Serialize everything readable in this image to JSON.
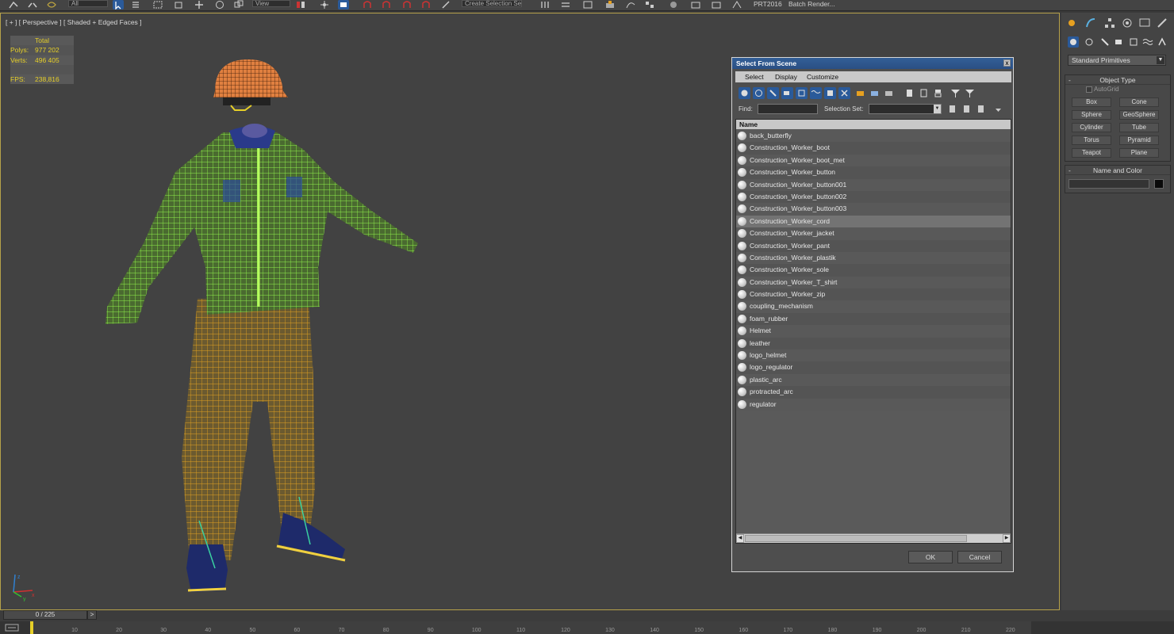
{
  "toolbar": {
    "filter_combo": "All",
    "view_combo": "View",
    "selection_set": "Create Selection Se",
    "plugin_label": "PRT2016",
    "batch_label": "Batch Render..."
  },
  "viewport": {
    "label": "[ + ] [ Perspective ] [ Shaded + Edged Faces ]",
    "stats": {
      "total_label": "Total",
      "polys_label": "Polys:",
      "polys_value": "977 202",
      "verts_label": "Verts:",
      "verts_value": "496 405",
      "fps_label": "FPS:",
      "fps_value": "238,816"
    },
    "axis_labels": {
      "x": "x",
      "y": "y",
      "z": "z"
    }
  },
  "command_panel": {
    "primitives_combo": "Standard Primitives",
    "object_type": {
      "title": "Object Type",
      "autogrid_label": "AutoGrid",
      "buttons": [
        "Box",
        "Cone",
        "Sphere",
        "GeoSphere",
        "Cylinder",
        "Tube",
        "Torus",
        "Pyramid",
        "Teapot",
        "Plane"
      ]
    },
    "name_color": {
      "title": "Name and Color",
      "name_value": "",
      "swatch_color": "#0a0a0a"
    }
  },
  "dialog": {
    "title": "Select From Scene",
    "close_label": "x",
    "menu": [
      "Select",
      "Display",
      "Customize"
    ],
    "find_label": "Find:",
    "find_value": "",
    "selection_set_label": "Selection Set:",
    "selection_set_value": "",
    "column_header": "Name",
    "objects": [
      "back_butterfly",
      "Construction_Worker_boot",
      "Construction_Worker_boot_met",
      "Construction_Worker_button",
      "Construction_Worker_button001",
      "Construction_Worker_button002",
      "Construction_Worker_button003",
      "Construction_Worker_cord",
      "Construction_Worker_jacket",
      "Construction_Worker_pant",
      "Construction_Worker_plastik",
      "Construction_Worker_sole",
      "Construction_Worker_T_shirt",
      "Construction_Worker_zip",
      "coupling_mechanism",
      "foam_rubber",
      "Helmet",
      "leather",
      "logo_helmet",
      "logo_regulator",
      "plastic_arc",
      "protracted_arc",
      "regulator"
    ],
    "selected_index": 7,
    "ok_label": "OK",
    "cancel_label": "Cancel"
  },
  "timeline": {
    "frame_display": "0 / 225",
    "next_label": ">",
    "ticks": [
      "10",
      "20",
      "30",
      "40",
      "50",
      "60",
      "70",
      "80",
      "90",
      "100",
      "110",
      "120",
      "130",
      "140",
      "150",
      "160",
      "170",
      "180",
      "190",
      "200",
      "210",
      "220"
    ]
  },
  "colors": {
    "accent_blue": "#2a4f84",
    "stats_yellow": "#e6cf28",
    "jacket_green": "#8ff04a",
    "pants_orange": "#e0a020",
    "boot_navy": "#1e2a6a"
  }
}
